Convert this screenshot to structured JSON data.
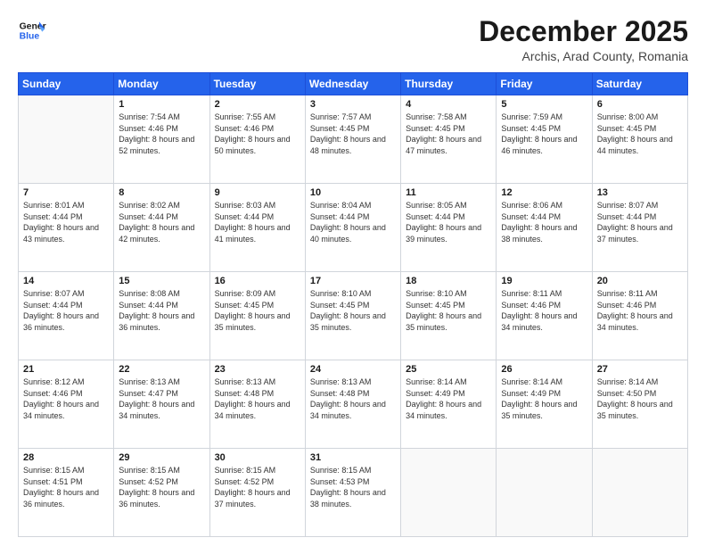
{
  "logo": {
    "line1": "General",
    "line2": "Blue"
  },
  "title": "December 2025",
  "subtitle": "Archis, Arad County, Romania",
  "header": {
    "days": [
      "Sunday",
      "Monday",
      "Tuesday",
      "Wednesday",
      "Thursday",
      "Friday",
      "Saturday"
    ]
  },
  "weeks": [
    [
      {
        "num": "",
        "sunrise": "",
        "sunset": "",
        "daylight": ""
      },
      {
        "num": "1",
        "sunrise": "Sunrise: 7:54 AM",
        "sunset": "Sunset: 4:46 PM",
        "daylight": "Daylight: 8 hours and 52 minutes."
      },
      {
        "num": "2",
        "sunrise": "Sunrise: 7:55 AM",
        "sunset": "Sunset: 4:46 PM",
        "daylight": "Daylight: 8 hours and 50 minutes."
      },
      {
        "num": "3",
        "sunrise": "Sunrise: 7:57 AM",
        "sunset": "Sunset: 4:45 PM",
        "daylight": "Daylight: 8 hours and 48 minutes."
      },
      {
        "num": "4",
        "sunrise": "Sunrise: 7:58 AM",
        "sunset": "Sunset: 4:45 PM",
        "daylight": "Daylight: 8 hours and 47 minutes."
      },
      {
        "num": "5",
        "sunrise": "Sunrise: 7:59 AM",
        "sunset": "Sunset: 4:45 PM",
        "daylight": "Daylight: 8 hours and 46 minutes."
      },
      {
        "num": "6",
        "sunrise": "Sunrise: 8:00 AM",
        "sunset": "Sunset: 4:45 PM",
        "daylight": "Daylight: 8 hours and 44 minutes."
      }
    ],
    [
      {
        "num": "7",
        "sunrise": "Sunrise: 8:01 AM",
        "sunset": "Sunset: 4:44 PM",
        "daylight": "Daylight: 8 hours and 43 minutes."
      },
      {
        "num": "8",
        "sunrise": "Sunrise: 8:02 AM",
        "sunset": "Sunset: 4:44 PM",
        "daylight": "Daylight: 8 hours and 42 minutes."
      },
      {
        "num": "9",
        "sunrise": "Sunrise: 8:03 AM",
        "sunset": "Sunset: 4:44 PM",
        "daylight": "Daylight: 8 hours and 41 minutes."
      },
      {
        "num": "10",
        "sunrise": "Sunrise: 8:04 AM",
        "sunset": "Sunset: 4:44 PM",
        "daylight": "Daylight: 8 hours and 40 minutes."
      },
      {
        "num": "11",
        "sunrise": "Sunrise: 8:05 AM",
        "sunset": "Sunset: 4:44 PM",
        "daylight": "Daylight: 8 hours and 39 minutes."
      },
      {
        "num": "12",
        "sunrise": "Sunrise: 8:06 AM",
        "sunset": "Sunset: 4:44 PM",
        "daylight": "Daylight: 8 hours and 38 minutes."
      },
      {
        "num": "13",
        "sunrise": "Sunrise: 8:07 AM",
        "sunset": "Sunset: 4:44 PM",
        "daylight": "Daylight: 8 hours and 37 minutes."
      }
    ],
    [
      {
        "num": "14",
        "sunrise": "Sunrise: 8:07 AM",
        "sunset": "Sunset: 4:44 PM",
        "daylight": "Daylight: 8 hours and 36 minutes."
      },
      {
        "num": "15",
        "sunrise": "Sunrise: 8:08 AM",
        "sunset": "Sunset: 4:44 PM",
        "daylight": "Daylight: 8 hours and 36 minutes."
      },
      {
        "num": "16",
        "sunrise": "Sunrise: 8:09 AM",
        "sunset": "Sunset: 4:45 PM",
        "daylight": "Daylight: 8 hours and 35 minutes."
      },
      {
        "num": "17",
        "sunrise": "Sunrise: 8:10 AM",
        "sunset": "Sunset: 4:45 PM",
        "daylight": "Daylight: 8 hours and 35 minutes."
      },
      {
        "num": "18",
        "sunrise": "Sunrise: 8:10 AM",
        "sunset": "Sunset: 4:45 PM",
        "daylight": "Daylight: 8 hours and 35 minutes."
      },
      {
        "num": "19",
        "sunrise": "Sunrise: 8:11 AM",
        "sunset": "Sunset: 4:46 PM",
        "daylight": "Daylight: 8 hours and 34 minutes."
      },
      {
        "num": "20",
        "sunrise": "Sunrise: 8:11 AM",
        "sunset": "Sunset: 4:46 PM",
        "daylight": "Daylight: 8 hours and 34 minutes."
      }
    ],
    [
      {
        "num": "21",
        "sunrise": "Sunrise: 8:12 AM",
        "sunset": "Sunset: 4:46 PM",
        "daylight": "Daylight: 8 hours and 34 minutes."
      },
      {
        "num": "22",
        "sunrise": "Sunrise: 8:13 AM",
        "sunset": "Sunset: 4:47 PM",
        "daylight": "Daylight: 8 hours and 34 minutes."
      },
      {
        "num": "23",
        "sunrise": "Sunrise: 8:13 AM",
        "sunset": "Sunset: 4:48 PM",
        "daylight": "Daylight: 8 hours and 34 minutes."
      },
      {
        "num": "24",
        "sunrise": "Sunrise: 8:13 AM",
        "sunset": "Sunset: 4:48 PM",
        "daylight": "Daylight: 8 hours and 34 minutes."
      },
      {
        "num": "25",
        "sunrise": "Sunrise: 8:14 AM",
        "sunset": "Sunset: 4:49 PM",
        "daylight": "Daylight: 8 hours and 34 minutes."
      },
      {
        "num": "26",
        "sunrise": "Sunrise: 8:14 AM",
        "sunset": "Sunset: 4:49 PM",
        "daylight": "Daylight: 8 hours and 35 minutes."
      },
      {
        "num": "27",
        "sunrise": "Sunrise: 8:14 AM",
        "sunset": "Sunset: 4:50 PM",
        "daylight": "Daylight: 8 hours and 35 minutes."
      }
    ],
    [
      {
        "num": "28",
        "sunrise": "Sunrise: 8:15 AM",
        "sunset": "Sunset: 4:51 PM",
        "daylight": "Daylight: 8 hours and 36 minutes."
      },
      {
        "num": "29",
        "sunrise": "Sunrise: 8:15 AM",
        "sunset": "Sunset: 4:52 PM",
        "daylight": "Daylight: 8 hours and 36 minutes."
      },
      {
        "num": "30",
        "sunrise": "Sunrise: 8:15 AM",
        "sunset": "Sunset: 4:52 PM",
        "daylight": "Daylight: 8 hours and 37 minutes."
      },
      {
        "num": "31",
        "sunrise": "Sunrise: 8:15 AM",
        "sunset": "Sunset: 4:53 PM",
        "daylight": "Daylight: 8 hours and 38 minutes."
      },
      {
        "num": "",
        "sunrise": "",
        "sunset": "",
        "daylight": ""
      },
      {
        "num": "",
        "sunrise": "",
        "sunset": "",
        "daylight": ""
      },
      {
        "num": "",
        "sunrise": "",
        "sunset": "",
        "daylight": ""
      }
    ]
  ]
}
